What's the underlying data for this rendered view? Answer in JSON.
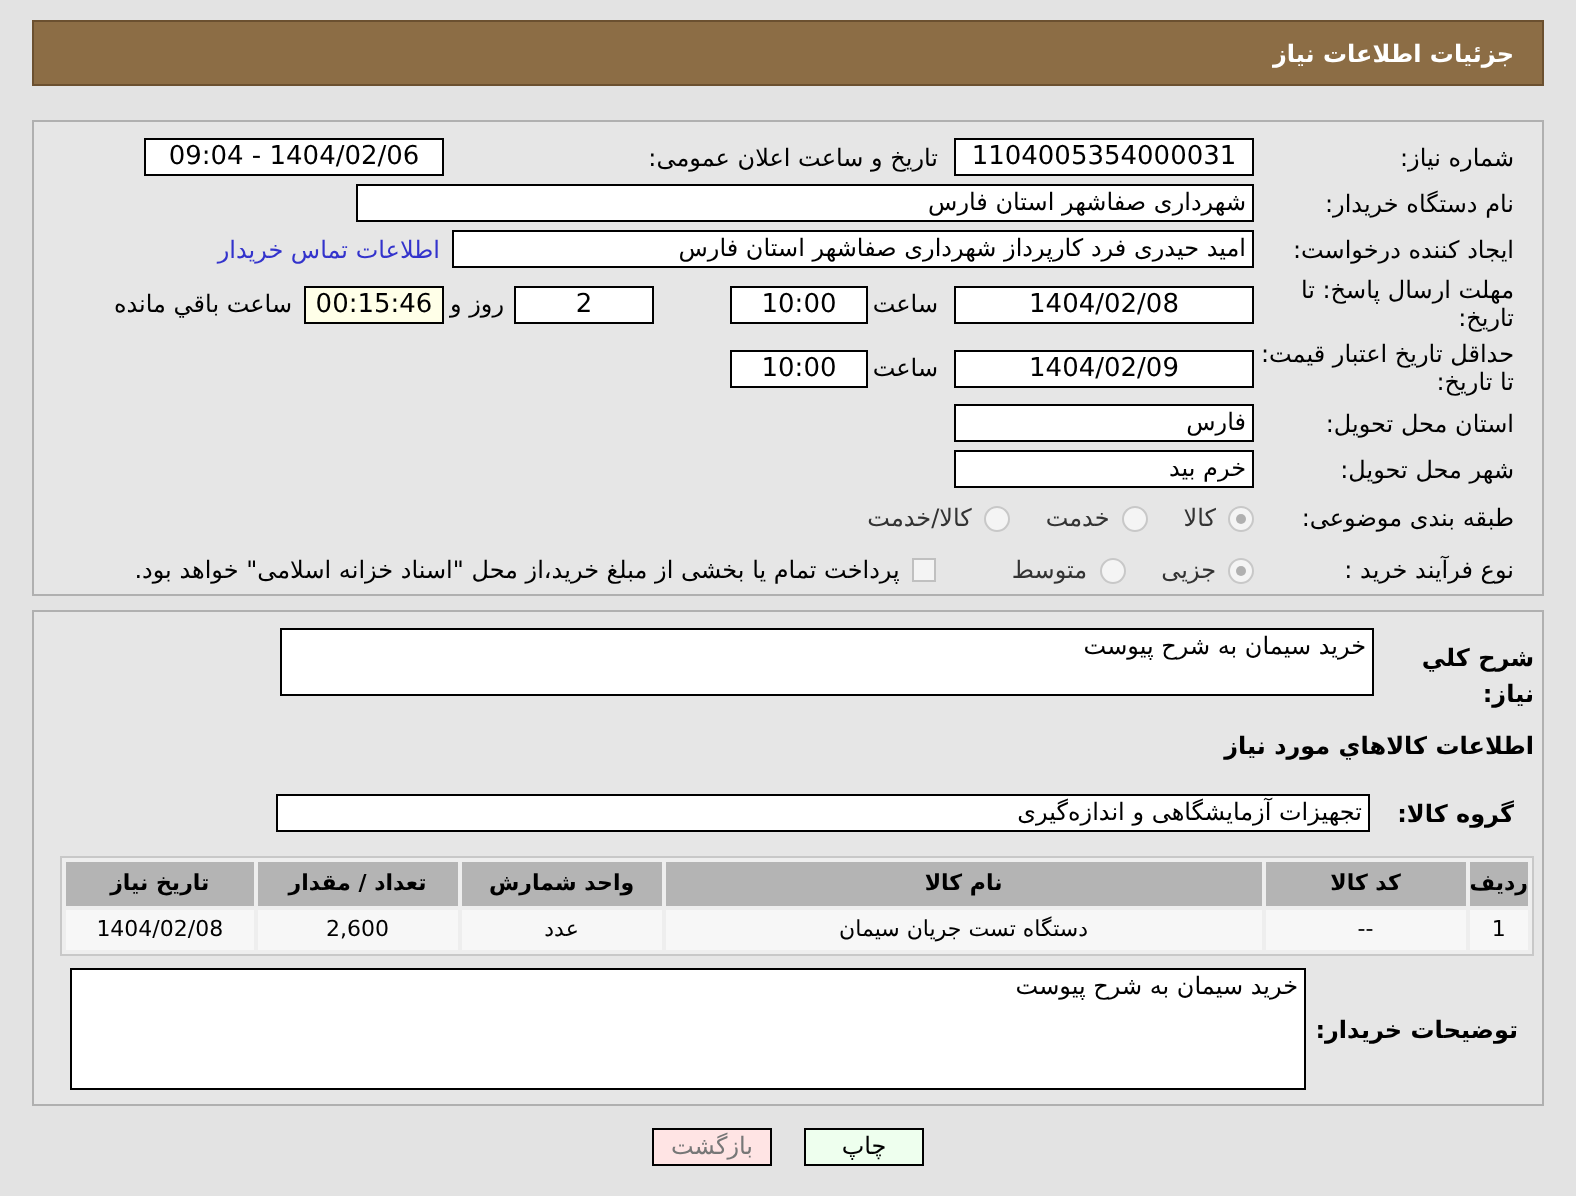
{
  "header": {
    "title": "جزئیات اطلاعات نیاز"
  },
  "need_number": {
    "label": "شماره نیاز:",
    "value": "1104005354000031"
  },
  "announce": {
    "label": "تاریخ و ساعت اعلان عمومی:",
    "value": "1404/02/06 - 09:04"
  },
  "buyer_org": {
    "label": "نام دستگاه خریدار:",
    "value": "شهرداری صفاشهر استان فارس"
  },
  "requester": {
    "label": "ایجاد کننده درخواست:",
    "value": "امید حیدری فرد کارپرداز شهرداری صفاشهر استان فارس"
  },
  "contact_link": "اطلاعات تماس خریدار",
  "deadline": {
    "label": "مهلت ارسال پاسخ: تا تاریخ:",
    "date": "1404/02/08",
    "time_label": "ساعت",
    "time": "10:00",
    "days": "2",
    "days_label": "روز و",
    "remaining": "00:15:46",
    "remaining_label": "ساعت باقي مانده"
  },
  "validity": {
    "label": "حداقل تاریخ اعتبار قیمت: تا تاریخ:",
    "date": "1404/02/09",
    "time_label": "ساعت",
    "time": "10:00"
  },
  "province": {
    "label": "استان محل تحویل:",
    "value": "فارس"
  },
  "city": {
    "label": "شهر محل تحویل:",
    "value": "خرم بید"
  },
  "category": {
    "label": "طبقه بندی موضوعی:",
    "options": [
      {
        "label": "کالا",
        "selected": true
      },
      {
        "label": "خدمت",
        "selected": false
      },
      {
        "label": "کالا/خدمت",
        "selected": false
      }
    ]
  },
  "process": {
    "label": "نوع فرآیند خرید :",
    "options": [
      {
        "label": "جزیی",
        "selected": true
      },
      {
        "label": "متوسط",
        "selected": false
      }
    ],
    "payment": {
      "label": "پرداخت تمام یا بخشی از مبلغ خرید،از محل \"اسناد خزانه اسلامی\" خواهد بود.",
      "checked": false
    }
  },
  "description": {
    "label": "شرح کلي نياز:",
    "value": "خرید سیمان به شرح پیوست"
  },
  "goods_title": "اطلاعات کالاهاي مورد نياز",
  "goods_group": {
    "label": "گروه کالا:",
    "value": "تجهیزات آزمایشگاهی و اندازه‌گیری"
  },
  "table": {
    "columns": [
      "ردیف",
      "کد کالا",
      "نام کالا",
      "واحد شمارش",
      "تعداد / مقدار",
      "تاریخ نیاز"
    ],
    "rows": [
      [
        "1",
        "--",
        "دستگاه تست جریان سیمان",
        "عدد",
        "2,600",
        "1404/02/08"
      ]
    ]
  },
  "buyer_notes": {
    "label": "توضیحات خریدار:",
    "value": "خرید سیمان به شرح پیوست"
  },
  "buttons": [
    {
      "label": "چاپ",
      "kind": "print"
    },
    {
      "label": "بازگشت",
      "kind": "back"
    }
  ]
}
